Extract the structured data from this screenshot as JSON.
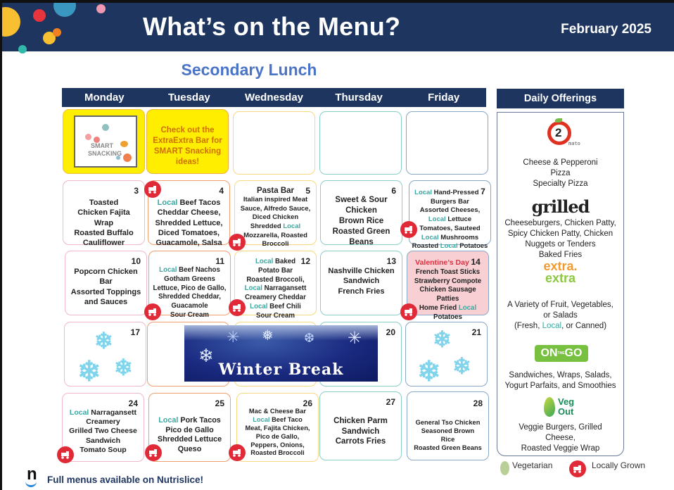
{
  "header": {
    "title": "What’s on the Menu?",
    "month": "February 2025",
    "subtitle": "Secondary Lunch"
  },
  "days": [
    "Monday",
    "Tuesday",
    "Wednesday",
    "Thursday",
    "Friday"
  ],
  "week0": {
    "mon_image": "SMART SNACKING",
    "tue_callout": "Check out the ExtraExtra Bar for SMART Snacking ideas!"
  },
  "cells": {
    "d3": {
      "num": "3",
      "lines": [
        "Toasted",
        "Chicken Fajita",
        "Wrap",
        "Roasted Buffalo",
        "Cauliflower"
      ]
    },
    "d4": {
      "num": "4",
      "local": "Local",
      "l1": " Beef Tacos",
      "lines": [
        "Cheddar Cheese,",
        "Shredded Lettuce,",
        "Diced Tomatoes,",
        "Guacamole, Salsa"
      ]
    },
    "d5": {
      "num": "5",
      "head": "Pasta Bar",
      "a": "Italian inspired Meat Sauce, Alfredo Sauce, Diced Chicken Shredded ",
      "local": "Local",
      "b": " Mozzarella, Roasted Broccoli"
    },
    "d6": {
      "num": "6",
      "lines": [
        "Sweet & Sour",
        "Chicken",
        "Brown Rice",
        "Roasted Green",
        "Beans"
      ]
    },
    "d7": {
      "num": "7",
      "local": "Local",
      "a": " Hand-Pressed",
      "b": "Burgers Bar",
      "c": "Assorted Cheeses,",
      "d": " Lettuce",
      "e": "Tomatoes, Sauteed",
      "f": " Mushrooms",
      "g": "Roasted ",
      "h": " Potatoes"
    },
    "d10": {
      "num": "10",
      "lines": [
        "Popcorn Chicken",
        "Bar",
        "Assorted Toppings",
        "and Sauces"
      ]
    },
    "d11": {
      "num": "11",
      "local": "Local",
      "l1": " Beef Nachos",
      "lines": [
        "Gotham Greens",
        "Lettuce, Pico de Gallo,",
        "Shredded Cheddar,",
        "Guacamole",
        "Sour Cream"
      ]
    },
    "d12": {
      "num": "12",
      "local": "Local",
      "a": " Baked",
      "b": "Potato Bar",
      "c": "Roasted Broccoli,",
      "d": " Narragansett",
      "e": "Creamery Cheddar",
      "f": " Beef Chili",
      "g": "Sour Cream"
    },
    "d13": {
      "num": "13",
      "lines": [
        "Nashville Chicken",
        "Sandwich",
        "French Fries"
      ]
    },
    "d14": {
      "num": "14",
      "holiday": "Valentine’s Day",
      "lines": [
        "French Toast Sticks",
        "Strawberry Compote",
        "Chicken Sausage",
        "Patties"
      ],
      "a": "Home Fried ",
      "local": "Local",
      "b": "Potatoes"
    },
    "d17": {
      "num": "17"
    },
    "d20": {
      "num": "20"
    },
    "d21": {
      "num": "21"
    },
    "winter": "Winter Break",
    "d24": {
      "num": "24",
      "local": "Local",
      "l1": " Narragansett",
      "lines": [
        "Creamery",
        "Grilled Two Cheese",
        "Sandwich",
        "Tomato Soup"
      ]
    },
    "d25": {
      "num": "25",
      "local": "Local",
      "l1": " Pork Tacos",
      "lines": [
        "Pico de Gallo",
        "Shredded Lettuce",
        "Queso"
      ]
    },
    "d26": {
      "num": "26",
      "a": "Mac & Cheese Bar",
      "local": "Local",
      "b": " Beef Taco",
      "lines": [
        "Meat, Fajita Chicken,",
        "Pico de Gallo,",
        "Peppers, Onions,",
        "Roasted Broccoli"
      ]
    },
    "d27": {
      "num": "27",
      "lines": [
        "Chicken Parm",
        "Sandwich",
        "Carrots Fries"
      ]
    },
    "d28": {
      "num": "28",
      "lines": [
        "General Tso Chicken",
        "Seasoned Brown",
        "Rice",
        "Roasted Green Beans"
      ]
    }
  },
  "sidebar": {
    "title": "Daily Offerings",
    "o2mato": {
      "logo_num": "2",
      "logo_text": "mato",
      "lines": [
        "Cheese & Pepperoni",
        "Pizza",
        "Specialty Pizza"
      ]
    },
    "grilled": {
      "logo": "grilled",
      "lines": [
        "Cheeseburgers, Chicken Patty,",
        "Spicy Chicken Patty, Chicken",
        "Nuggets or Tenders",
        "Baked Fries"
      ]
    },
    "extra": {
      "logo1": "extra.",
      "logo2": "extra",
      "l1": "A Variety of Fruit, Vegetables,",
      "l2": "or Salads",
      "l3a": "(Fresh, ",
      "local": "Local",
      "l3b": ", or Canned)"
    },
    "onthego": {
      "logo": "ON",
      "logo_mid": "THE",
      "logo_end": "GO",
      "lines": [
        "Sandwiches, Wraps, Salads,",
        "Yogurt Parfaits, and Smoothies"
      ]
    },
    "vegout": {
      "logo1": "Veg",
      "logo2": "Out",
      "lines": [
        "Veggie Burgers, Grilled",
        "Cheese,",
        "Roasted Veggie Wrap"
      ]
    }
  },
  "legend": {
    "vegetarian": "Vegetarian",
    "local": "Locally Grown"
  },
  "footer": {
    "logo": "n",
    "text": "Full menus available on Nutrislice!"
  },
  "colors": {
    "navy": "#1e3560",
    "local": "#3aa8a0",
    "badge": "#e02a38",
    "subtitle": "#4a74c8"
  }
}
